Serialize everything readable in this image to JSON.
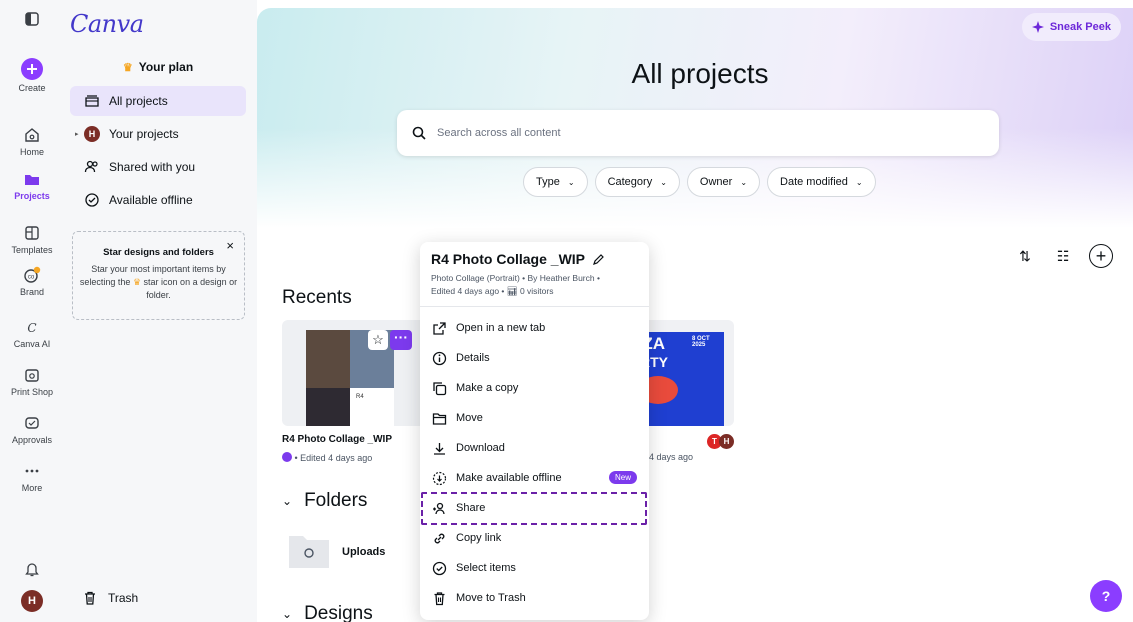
{
  "rail": {
    "items": [
      {
        "label": "Create"
      },
      {
        "label": "Home"
      },
      {
        "label": "Projects"
      },
      {
        "label": "Templates"
      },
      {
        "label": "Brand"
      },
      {
        "label": "Canva AI"
      },
      {
        "label": "Print Shop"
      },
      {
        "label": "Approvals"
      },
      {
        "label": "More"
      }
    ],
    "user_initial": "H"
  },
  "sidebar": {
    "logo": "Canva",
    "plan": "Your plan",
    "nav": [
      {
        "label": "All projects"
      },
      {
        "label": "Your projects",
        "avatar": "H"
      },
      {
        "label": "Shared with you"
      },
      {
        "label": "Available offline"
      }
    ],
    "tip": {
      "title": "Star designs and folders",
      "body_prefix": "Star your most important items by selecting the",
      "body_suffix": "star icon on a design or folder.",
      "close": "×"
    },
    "trash": "Trash"
  },
  "main": {
    "sneak_peek": "Sneak Peek",
    "title": "All projects",
    "search_placeholder": "Search across all content",
    "filters": [
      "Type",
      "Category",
      "Owner",
      "Date modified"
    ],
    "recents_heading": "Recents",
    "cards": [
      {
        "title": "R4 Photo Collage _WIP",
        "meta": "• Edited 4 days ago",
        "thumb_label": "R4"
      },
      {
        "title": "",
        "meta": "4 days ago",
        "thumb_text": "ZZA",
        "thumb_sub": "RTY",
        "date": "8 OCT 2025",
        "avatars": [
          "T",
          "H"
        ]
      }
    ],
    "folders_heading": "Folders",
    "folder_uploads": "Uploads",
    "designs_heading": "Designs"
  },
  "menu": {
    "title": "R4 Photo Collage _WIP",
    "sub1": "Photo Collage (Portrait) • By Heather Burch •",
    "sub2_prefix": "Edited 4 days ago •",
    "sub2_suffix": "0 visitors",
    "items": [
      {
        "label": "Open in a new tab"
      },
      {
        "label": "Details"
      },
      {
        "label": "Make a copy"
      },
      {
        "label": "Move"
      },
      {
        "label": "Download"
      },
      {
        "label": "Make available offline",
        "badge": "New"
      },
      {
        "label": "Share"
      },
      {
        "label": "Copy link"
      },
      {
        "label": "Select items"
      },
      {
        "label": "Move to Trash"
      }
    ]
  },
  "help": "?",
  "colors": {
    "accent": "#8b3dff",
    "highlight": "#6b21a8",
    "active_nav": "#e9e4fb"
  }
}
